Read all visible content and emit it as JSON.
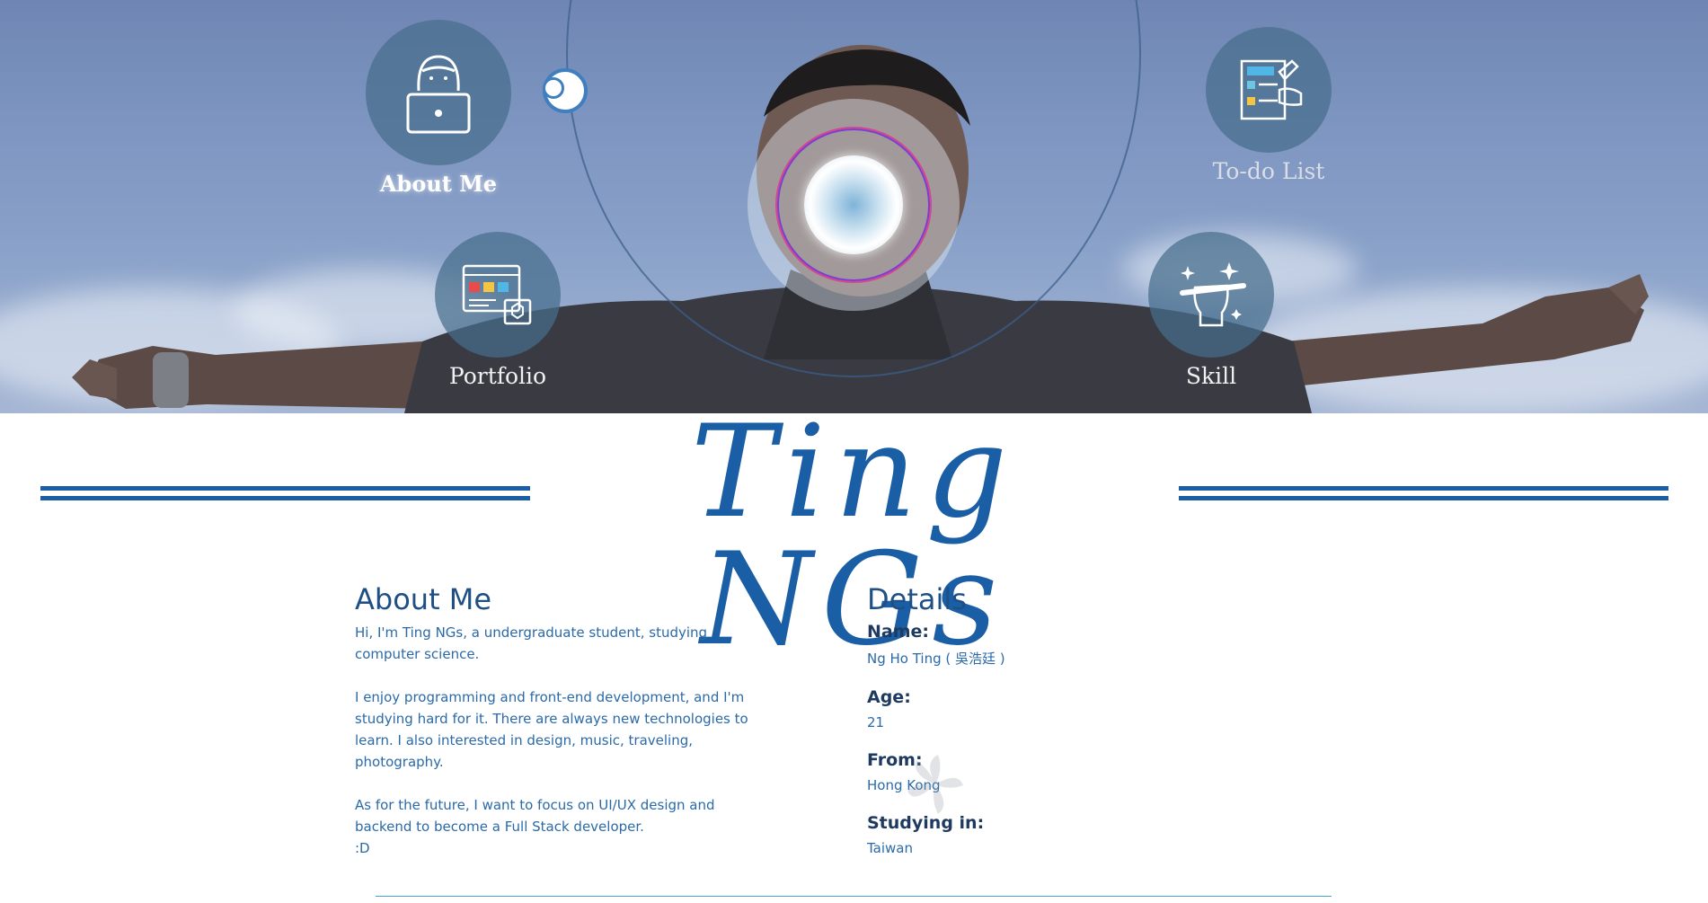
{
  "hero": {
    "nav": {
      "about": {
        "label": "About Me",
        "icon": "laptop-person-icon"
      },
      "todo": {
        "label": "To-do List",
        "icon": "checklist-icon"
      },
      "portfolio": {
        "label": "Portfolio",
        "icon": "browser-window-icon"
      },
      "skill": {
        "label": "Skill",
        "icon": "hand-pen-icon"
      }
    },
    "center_button_icon": "radial-menu-button"
  },
  "site_title": "Ting NGs",
  "about": {
    "heading": "About Me",
    "p1": "Hi, I'm Ting NGs, a undergraduate student, studying computer science.",
    "p2": "I enjoy programming and front-end development, and I'm studying hard for it. There are always new technologies to learn. I also interested in design, music, traveling, photography.",
    "p3": "As for the future, I want to focus on UI/UX design and backend to become a Full Stack developer.",
    "p4": ":D"
  },
  "details": {
    "heading": "Details",
    "name_label": "Name:",
    "name_value": "Ng Ho Ting ( 吳浩廷 )",
    "age_label": "Age:",
    "age_value": "21",
    "from_label": "From:",
    "from_value": "Hong Kong",
    "studying_label": "Studying in:",
    "studying_value": "Taiwan"
  },
  "colors": {
    "accent": "#1a5ea6",
    "text_blue": "#2b6aa8",
    "heading": "#1e4f85",
    "nav_circle": "#466e8c"
  }
}
